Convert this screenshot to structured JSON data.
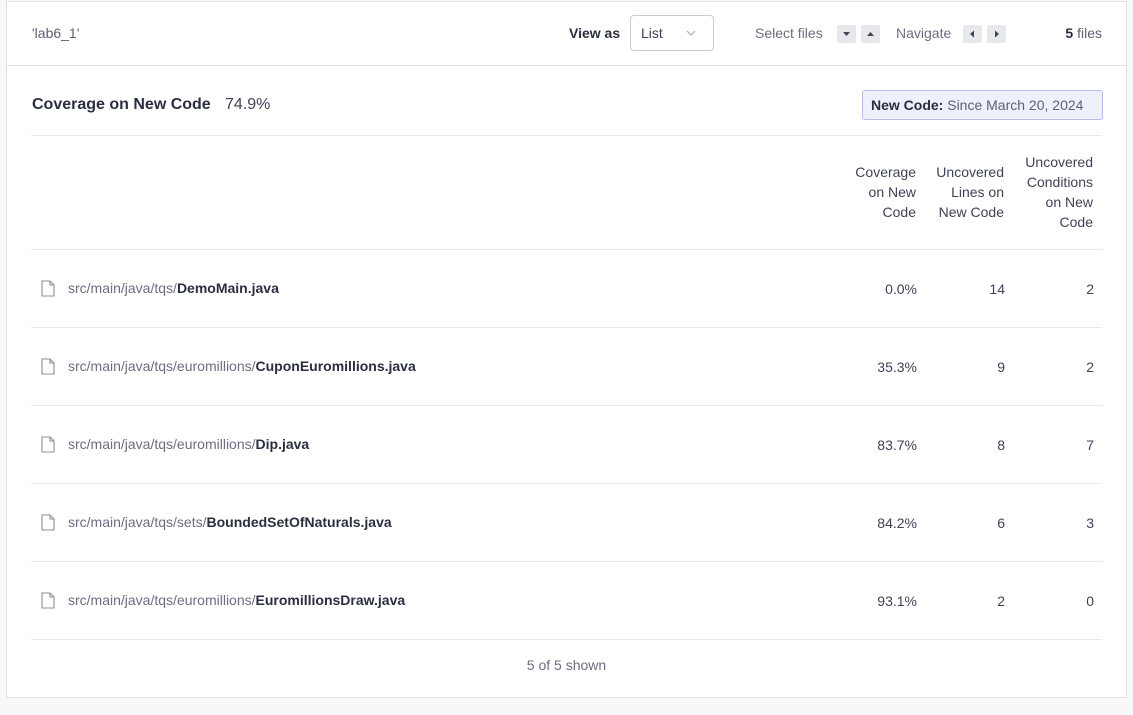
{
  "toolbar": {
    "breadcrumb": "'lab6_1'",
    "view_as_label": "View as",
    "view_as_value": "List",
    "select_files_label": "Select files",
    "navigate_label": "Navigate",
    "files_count": "5",
    "files_suffix": "files"
  },
  "coverage": {
    "title": "Coverage on New Code",
    "value": "74.9%"
  },
  "new_code": {
    "key": "New Code:",
    "value": "Since March 20, 2024"
  },
  "columns": {
    "coverage": [
      "Coverage",
      "on New",
      "Code"
    ],
    "uncovered_lines": [
      "Uncovered",
      "Lines on",
      "New Code"
    ],
    "uncovered_conditions": [
      "Uncovered",
      "Conditions",
      "on New",
      "Code"
    ]
  },
  "rows": [
    {
      "dir": "src/main/java/tqs/",
      "file": "DemoMain.java",
      "coverage": "0.0%",
      "lines": "14",
      "conditions": "2"
    },
    {
      "dir": "src/main/java/tqs/euromillions/",
      "file": "CuponEuromillions.java",
      "coverage": "35.3%",
      "lines": "9",
      "conditions": "2"
    },
    {
      "dir": "src/main/java/tqs/euromillions/",
      "file": "Dip.java",
      "coverage": "83.7%",
      "lines": "8",
      "conditions": "7"
    },
    {
      "dir": "src/main/java/tqs/sets/",
      "file": "BoundedSetOfNaturals.java",
      "coverage": "84.2%",
      "lines": "6",
      "conditions": "3"
    },
    {
      "dir": "src/main/java/tqs/euromillions/",
      "file": "EuromillionsDraw.java",
      "coverage": "93.1%",
      "lines": "2",
      "conditions": "0"
    }
  ],
  "footer": {
    "shown": "5 of 5 shown"
  },
  "icons": {
    "file": "file-icon",
    "chevron": "chevron-down-icon",
    "arrow_down": "caret-down-icon",
    "arrow_up": "caret-up-icon",
    "arrow_left": "caret-left-icon",
    "arrow_right": "caret-right-icon"
  },
  "colors": {
    "badge_bg": "#eef0fb",
    "badge_border": "#b7bde6",
    "text_dark": "#2a2f40",
    "text_muted": "#6a6e80"
  }
}
